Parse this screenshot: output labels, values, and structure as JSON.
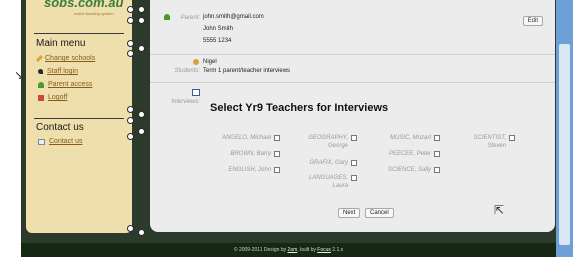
{
  "logo": {
    "text": "sobs.com.au",
    "tagline": "online booking system"
  },
  "sidebar": {
    "main_menu": "Main menu",
    "items": [
      {
        "label": "Change schools",
        "icon": "pencil-icon"
      },
      {
        "label": "Staff login",
        "icon": "pin-icon"
      },
      {
        "label": "Parent access",
        "icon": "person-icon"
      },
      {
        "label": "Logoff",
        "icon": "exit-icon"
      }
    ],
    "contact": "Contact us",
    "contact_item": {
      "label": "Contact us",
      "icon": "mail-icon"
    }
  },
  "parent": {
    "label": "Parent:",
    "email": "john.smith@gmail.com",
    "name": "John Smith",
    "phone": "5555 1234",
    "edit_label": "Edit"
  },
  "students": {
    "label": "Students:",
    "name": "Nigel",
    "event": "Term 1 parent/teacher interviews"
  },
  "interviews": {
    "label": "Interviews:",
    "title": "Select Yr9 Teachers for Interviews",
    "teachers": [
      {
        "name": "ANGELO, Michael"
      },
      {
        "name": "BROWN, Barry"
      },
      {
        "name": "ENGLISH, John"
      },
      {
        "name": "GEOGRAPHY, George"
      },
      {
        "name": "GRAFIX, Gary"
      },
      {
        "name": "LANGUAGES, Laura"
      },
      {
        "name": "MUSIC, Mozart"
      },
      {
        "name": "PEECEE, Peter"
      },
      {
        "name": "SCIENCE, Sally"
      },
      {
        "name": "SCIENTIST, Steven"
      }
    ],
    "next_label": "Next",
    "cancel_label": "Cancel"
  },
  "footer": {
    "text": "© 2009-2011 Design by",
    "designer": "2am",
    "built_text": ", built by",
    "builder": "Focus",
    "version": "2.1.x"
  }
}
